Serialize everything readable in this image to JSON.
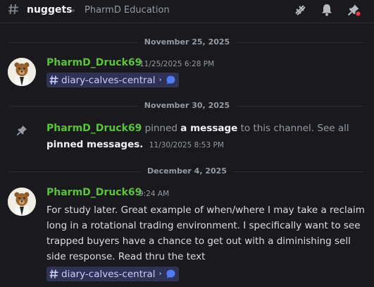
{
  "header": {
    "channel_name": "nuggets",
    "topic": "PharmD Education",
    "icons": [
      "hash-icon",
      "threads-icon",
      "bell-icon",
      "pin-icon"
    ]
  },
  "dividers": [
    "November 25, 2025",
    "November 30, 2025",
    "December 4, 2025"
  ],
  "messages": [
    {
      "author": "PharmD_Druck69",
      "timestamp": "11/25/2025 6:28 PM",
      "channel_link": {
        "label": "diary-calves-central",
        "arrow": "›"
      }
    },
    {
      "author": "PharmD_Druck69",
      "timestamp": "9:24 AM",
      "lines": [
        "For study later. Great example of when/where I may take a reclaim",
        "long in a rotational trading environment. I specifically want to see",
        "trapped buyers have a chance to get out with a diminishing sell",
        "side response. Read thru the text"
      ],
      "channel_link": {
        "label": "diary-calves-central",
        "arrow": "›"
      }
    }
  ],
  "system": {
    "author": "PharmD_Druck69",
    "pinned_text": " pinned ",
    "a_message": "a message",
    "to_channel": " to this channel. See all",
    "pinned_messages": "pinned messages",
    "period": ".",
    "timestamp": "11/30/2025 8:53 PM"
  },
  "colors": {
    "background": "#1a1a1e",
    "username": "#57c43a",
    "muted": "#949ba4",
    "chip_bg": "#2f3155",
    "chip_text": "#c9cdfb"
  }
}
